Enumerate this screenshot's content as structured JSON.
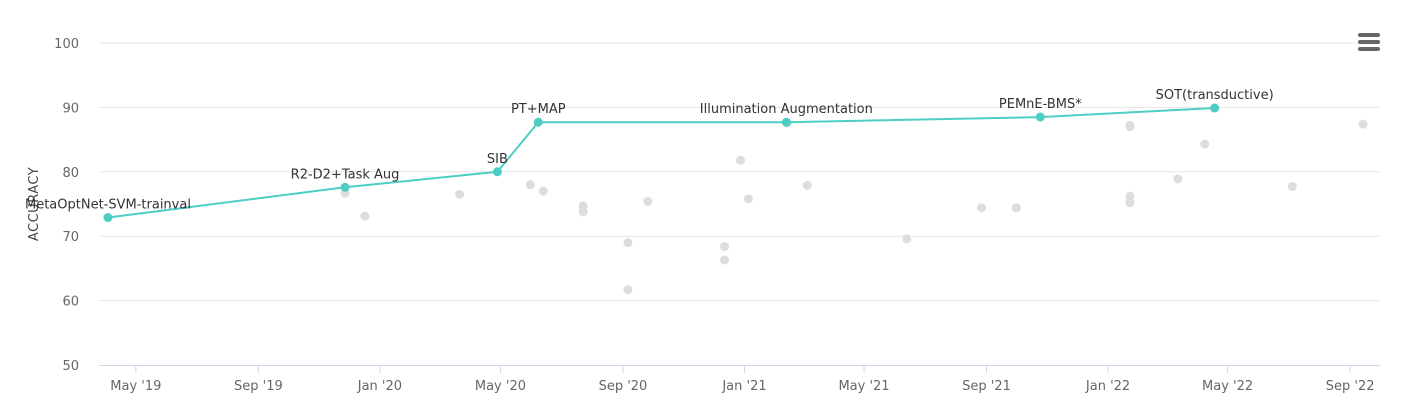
{
  "chart_data": {
    "type": "scatter",
    "ylabel": "ACCURACY",
    "xlabel": "",
    "ylim": [
      50,
      100
    ],
    "yticks": [
      50,
      60,
      70,
      80,
      90,
      100
    ],
    "xlim": [
      "2019-03-25",
      "2022-10-01"
    ],
    "xticks": [
      {
        "date": "2019-05-01",
        "label": "May '19"
      },
      {
        "date": "2019-09-01",
        "label": "Sep '19"
      },
      {
        "date": "2020-01-01",
        "label": "Jan '20"
      },
      {
        "date": "2020-05-01",
        "label": "May '20"
      },
      {
        "date": "2020-09-01",
        "label": "Sep '20"
      },
      {
        "date": "2021-01-01",
        "label": "Jan '21"
      },
      {
        "date": "2021-05-01",
        "label": "May '21"
      },
      {
        "date": "2021-09-01",
        "label": "Sep '21"
      },
      {
        "date": "2022-01-01",
        "label": "Jan '22"
      },
      {
        "date": "2022-05-01",
        "label": "May '22"
      },
      {
        "date": "2022-09-01",
        "label": "Sep '22"
      }
    ],
    "grid": true,
    "colors": {
      "sota": "#4ecdc4",
      "other": "#dddddd",
      "grid": "#e6e6e6",
      "axis": "#ccd6eb"
    },
    "sota_series": [
      {
        "date": "2019-04-03",
        "y": 72.9,
        "label": "MetaOptNet-SVM-trainval"
      },
      {
        "date": "2019-11-27",
        "y": 77.6,
        "label": "R2-D2+Task Aug"
      },
      {
        "date": "2020-04-28",
        "y": 80.0,
        "label": "SIB"
      },
      {
        "date": "2020-06-08",
        "y": 87.7,
        "label": "PT+MAP"
      },
      {
        "date": "2021-02-12",
        "y": 87.7,
        "label": "Illumination Augmentation"
      },
      {
        "date": "2021-10-25",
        "y": 88.5,
        "label": "PEMnE-BMS*"
      },
      {
        "date": "2022-04-18",
        "y": 89.9,
        "label": "SOT(transductive)"
      }
    ],
    "other_points": [
      {
        "date": "2019-11-27",
        "y": 76.7
      },
      {
        "date": "2019-12-17",
        "y": 73.1
      },
      {
        "date": "2020-03-21",
        "y": 76.5
      },
      {
        "date": "2020-05-31",
        "y": 78.0
      },
      {
        "date": "2020-06-13",
        "y": 77.0
      },
      {
        "date": "2020-07-23",
        "y": 74.7
      },
      {
        "date": "2020-07-23",
        "y": 73.8
      },
      {
        "date": "2020-09-06",
        "y": 69.0
      },
      {
        "date": "2020-09-06",
        "y": 61.7
      },
      {
        "date": "2020-09-26",
        "y": 75.4
      },
      {
        "date": "2020-12-12",
        "y": 68.4
      },
      {
        "date": "2020-12-12",
        "y": 66.3
      },
      {
        "date": "2020-12-28",
        "y": 81.8
      },
      {
        "date": "2021-01-05",
        "y": 75.8
      },
      {
        "date": "2021-02-13",
        "y": 87.6
      },
      {
        "date": "2021-03-05",
        "y": 77.9
      },
      {
        "date": "2021-06-13",
        "y": 69.6
      },
      {
        "date": "2021-08-27",
        "y": 74.4
      },
      {
        "date": "2021-10-01",
        "y": 74.4
      },
      {
        "date": "2022-01-23",
        "y": 87.2
      },
      {
        "date": "2022-01-23",
        "y": 87.0
      },
      {
        "date": "2022-01-23",
        "y": 76.2
      },
      {
        "date": "2022-01-23",
        "y": 75.2
      },
      {
        "date": "2022-03-12",
        "y": 78.9
      },
      {
        "date": "2022-04-08",
        "y": 84.3
      },
      {
        "date": "2022-07-05",
        "y": 77.7
      },
      {
        "date": "2022-09-14",
        "y": 87.4
      }
    ]
  },
  "menu": {
    "icon": "hamburger-menu-icon"
  }
}
